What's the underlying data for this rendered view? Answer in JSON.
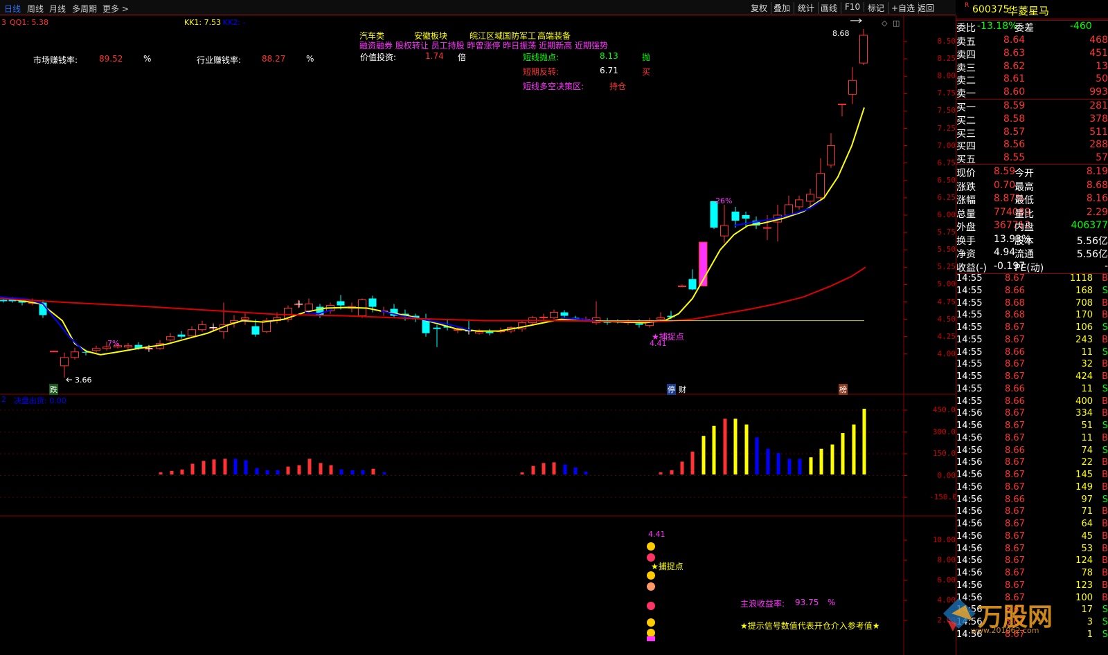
{
  "toolbar": {
    "tabs": [
      "日线",
      "周线",
      "月线",
      "多周期",
      "更多 >"
    ],
    "right": [
      "复权",
      "叠加",
      "统计",
      "画线",
      "F10",
      "标记",
      "+自选",
      "返回"
    ]
  },
  "header": {
    "code": "600375",
    "name": "华菱星马",
    "r_mark": "R"
  },
  "indicator_line": {
    "a": "3",
    "qq1": "QQ1: 5.38",
    "kk1": "KK1: 7.53",
    "kk2": "KK2: -"
  },
  "info": {
    "market_label": "市场赚钱率:",
    "market_val": "89.52",
    "pct1": "%",
    "industry_label": "行业赚钱率:",
    "industry_val": "88.27",
    "pct2": "%",
    "tags1": [
      "汽车类",
      "安徽板块",
      "皖江区域",
      "国防军工",
      "高端装备"
    ],
    "tags2": "融资融券 股权转让 员工持股 昨曾涨停 昨日振荡 近期新高 近期强势",
    "value_label": "价值投资:",
    "value_val": "1.74",
    "value_unit": "倍",
    "short_sell_label": "短线抛点:",
    "short_sell_val": "8.13",
    "short_sell_flag": "抛",
    "short_rev_label": "短期反转:",
    "short_rev_val": "6.71",
    "short_rev_flag": "买",
    "short_zone_label": "短线多空决策区:",
    "short_zone_val": "持仓"
  },
  "annot": {
    "high": "8.68",
    "low": "3.66",
    "pct7": "7%",
    "pct26": "26%",
    "catch": "★捕捉点",
    "catch_val": "4.41",
    "die": "跌",
    "ting": "停",
    "cai": "财",
    "bang": "榜"
  },
  "sub1": {
    "label_a": "2",
    "label": "决盘出货: 0.00"
  },
  "sub2": {
    "val": "4.41",
    "catch": "★捕捉点",
    "yield_label": "主浪收益率:",
    "yield_val": "93.75",
    "yield_pct": "%",
    "tip": "★提示信号数值代表开仓介入参考值★"
  },
  "axis_main": [
    "8.50",
    "8.25",
    "8.00",
    "7.75",
    "7.50",
    "7.25",
    "7.00",
    "6.75",
    "6.50",
    "6.25",
    "6.00",
    "5.75",
    "5.50",
    "5.25",
    "5.00",
    "4.75",
    "4.50",
    "4.25",
    "4.00"
  ],
  "axis_sub1": [
    "450.0",
    "300.0",
    "150.0",
    "0.00",
    "-150.0"
  ],
  "axis_sub2": [
    "10.00",
    "8.00",
    "6.00",
    "4.00",
    "2.00"
  ],
  "order": {
    "wb_label": "委比",
    "wb_val": "-13.18%",
    "wc_label": "委差",
    "wc_val": "-460",
    "asks": [
      {
        "l": "卖五",
        "p": "8.64",
        "v": "468"
      },
      {
        "l": "卖四",
        "p": "8.63",
        "v": "451"
      },
      {
        "l": "卖三",
        "p": "8.62",
        "v": "13"
      },
      {
        "l": "卖二",
        "p": "8.61",
        "v": "50"
      },
      {
        "l": "卖一",
        "p": "8.60",
        "v": "993"
      }
    ],
    "bids": [
      {
        "l": "买一",
        "p": "8.59",
        "v": "281"
      },
      {
        "l": "买二",
        "p": "8.58",
        "v": "378"
      },
      {
        "l": "买三",
        "p": "8.57",
        "v": "511"
      },
      {
        "l": "买四",
        "p": "8.56",
        "v": "288"
      },
      {
        "l": "买五",
        "p": "8.55",
        "v": "57"
      }
    ]
  },
  "quote": [
    {
      "l1": "现价",
      "v1": "8.59",
      "l2": "今开",
      "v2": "8.19"
    },
    {
      "l1": "涨跌",
      "v1": "0.70",
      "l2": "最高",
      "v2": "8.68"
    },
    {
      "l1": "涨幅",
      "v1": "8.87%",
      "l2": "最低",
      "v2": "8.16"
    },
    {
      "l1": "总量",
      "v1": "774089",
      "l2": "量比",
      "v2": "2.29"
    },
    {
      "l1": "外盘",
      "v1": "367712",
      "l2": "内盘",
      "v2": "406377"
    },
    {
      "l1": "换手",
      "v1": "13.93%",
      "l2": "股本",
      "v2": "5.56亿"
    },
    {
      "l1": "净资",
      "v1": "4.94",
      "l2": "流通",
      "v2": "5.56亿"
    },
    {
      "l1": "收益(-)",
      "v1": "-0.197",
      "l2": "PE(动)",
      "v2": "-"
    }
  ],
  "ticks": [
    [
      "14:55",
      "8.67",
      "1118",
      "B"
    ],
    [
      "14:55",
      "8.66",
      "168",
      "S"
    ],
    [
      "14:55",
      "8.68",
      "708",
      "B"
    ],
    [
      "14:55",
      "8.68",
      "170",
      "B"
    ],
    [
      "14:55",
      "8.67",
      "106",
      "S"
    ],
    [
      "14:55",
      "8.67",
      "243",
      "B"
    ],
    [
      "14:55",
      "8.66",
      "11",
      "S"
    ],
    [
      "14:55",
      "8.67",
      "32",
      "B"
    ],
    [
      "14:55",
      "8.67",
      "424",
      "B"
    ],
    [
      "14:55",
      "8.66",
      "11",
      "S"
    ],
    [
      "14:55",
      "8.66",
      "400",
      "B"
    ],
    [
      "14:56",
      "8.67",
      "334",
      "B"
    ],
    [
      "14:56",
      "8.67",
      "51",
      "S"
    ],
    [
      "14:56",
      "8.67",
      "11",
      "B"
    ],
    [
      "14:56",
      "8.66",
      "74",
      "S"
    ],
    [
      "14:56",
      "8.67",
      "22",
      "B"
    ],
    [
      "14:56",
      "8.67",
      "145",
      "B"
    ],
    [
      "14:56",
      "8.67",
      "149",
      "B"
    ],
    [
      "14:56",
      "8.66",
      "97",
      "S"
    ],
    [
      "14:56",
      "8.67",
      "71",
      "B"
    ],
    [
      "14:56",
      "8.67",
      "64",
      "B"
    ],
    [
      "14:56",
      "8.67",
      "45",
      "B"
    ],
    [
      "14:56",
      "8.67",
      "53",
      "B"
    ],
    [
      "14:56",
      "8.67",
      "124",
      "B"
    ],
    [
      "14:56",
      "8.67",
      "78",
      "B"
    ],
    [
      "14:56",
      "8.67",
      "123",
      "B"
    ],
    [
      "14:56",
      "8.67",
      "100",
      "B"
    ],
    [
      "14:56",
      "8.67",
      "17",
      "S"
    ],
    [
      "14:56",
      "8.67",
      "3",
      "S"
    ],
    [
      "14:56",
      "8.67",
      "1",
      "S"
    ]
  ],
  "watermark": {
    "text": "万股网",
    "url": "www.201062.com"
  },
  "colors": {
    "up": "#ff3333",
    "down": "#00ffff",
    "ma_fast": "#ffff00",
    "ma_blue": "#0000ff",
    "ma_red": "#dd0000",
    "axis": "#c00"
  }
}
